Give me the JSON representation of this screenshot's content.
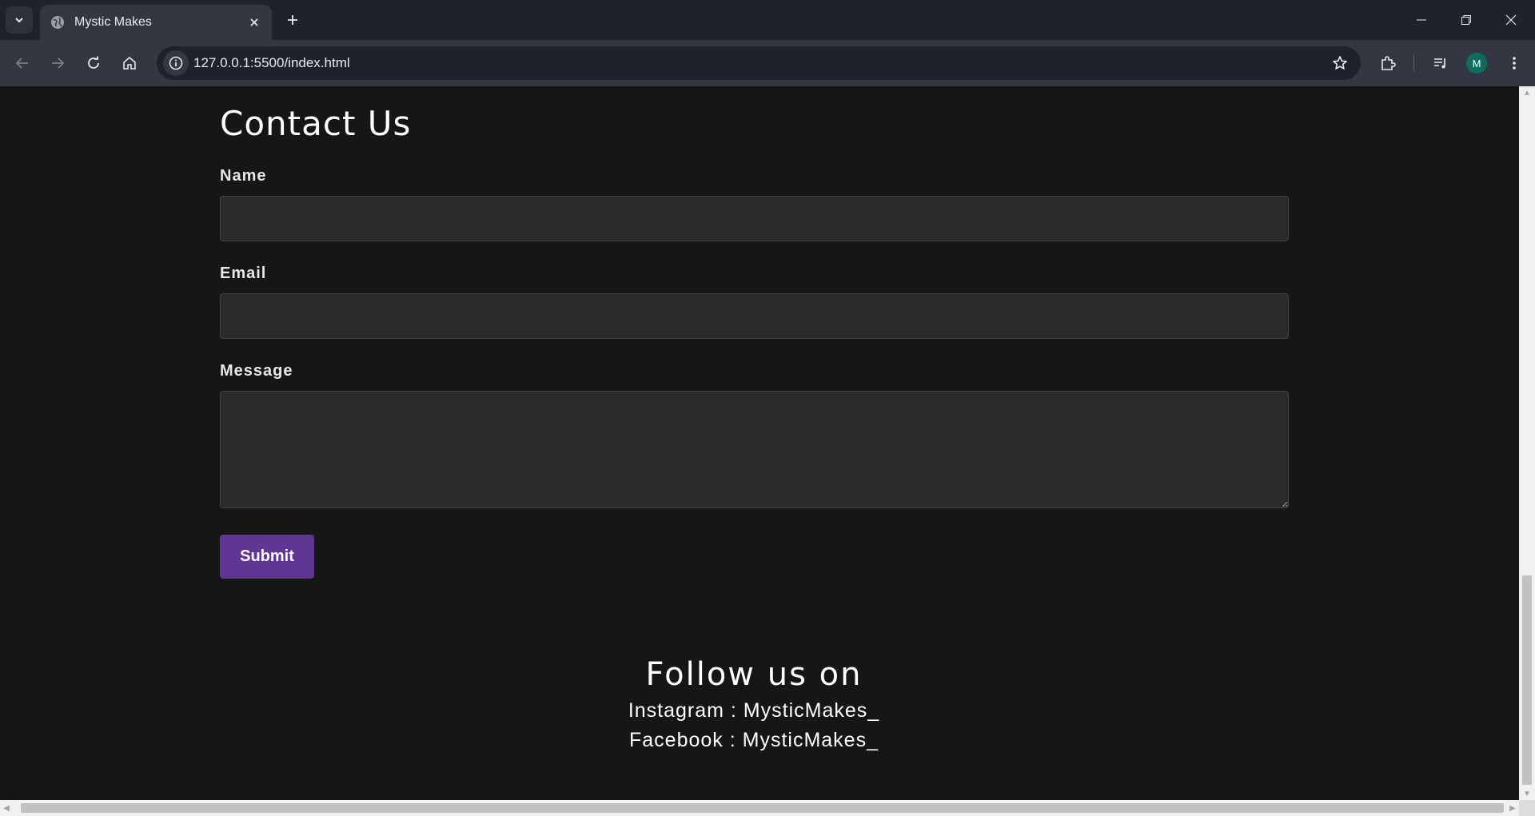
{
  "browser": {
    "tab_title": "Mystic Makes",
    "url": "127.0.0.1:5500/index.html",
    "profile_initial": "M",
    "icons": {
      "tab_list": "chevron-down-icon",
      "favicon": "globe-icon",
      "close_tab": "close-icon",
      "new_tab": "plus-icon",
      "back": "arrow-left-icon",
      "forward": "arrow-right-icon",
      "reload": "reload-icon",
      "home": "home-icon",
      "site_info": "info-icon",
      "bookmark": "star-icon",
      "extensions": "puzzle-icon",
      "media": "media-queue-icon",
      "menu": "kebab-menu-icon"
    }
  },
  "contact": {
    "heading": "Contact Us",
    "name_label": "Name",
    "name_value": "",
    "email_label": "Email",
    "email_value": "",
    "message_label": "Message",
    "message_value": "",
    "submit_label": "Submit"
  },
  "footer": {
    "heading": "Follow us on",
    "instagram": "Instagram : MysticMakes_",
    "facebook": "Facebook : MysticMakes_"
  },
  "colors": {
    "page_bg": "#161616",
    "input_bg": "#2b292a",
    "submit_bg": "#5f3693",
    "tabbar_bg": "#1e222b",
    "toolbar_bg": "#323742",
    "avatar_bg": "#0d6e5e"
  }
}
